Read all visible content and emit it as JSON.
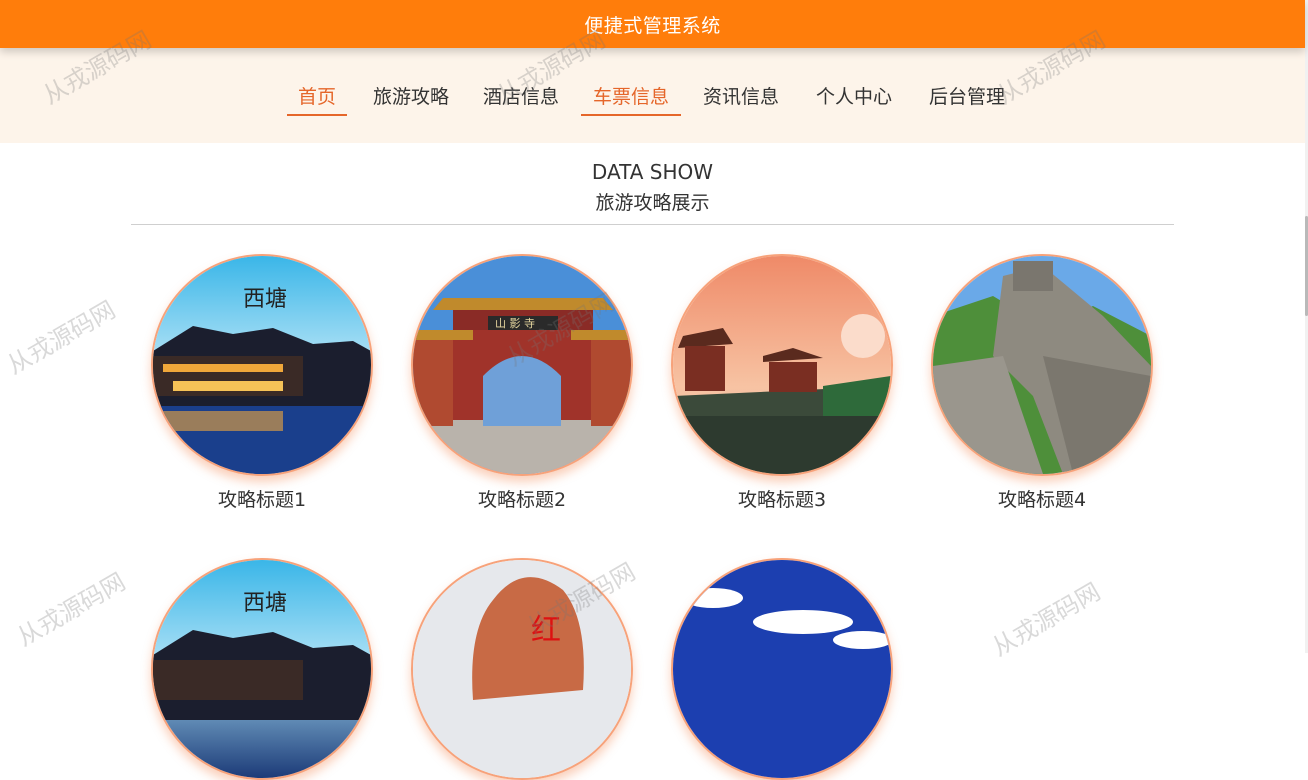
{
  "header": {
    "title": "便捷式管理系统"
  },
  "nav": {
    "items": [
      {
        "label": "首页",
        "active": true
      },
      {
        "label": "旅游攻略",
        "active": false
      },
      {
        "label": "酒店信息",
        "active": false
      },
      {
        "label": "车票信息",
        "active": true
      },
      {
        "label": "资讯信息",
        "active": false
      },
      {
        "label": "个人中心",
        "active": false
      },
      {
        "label": "后台管理",
        "active": false
      }
    ]
  },
  "section": {
    "title_en": "DATA SHOW",
    "title_cn": "旅游攻略展示"
  },
  "cards": [
    {
      "title": "攻略标题1",
      "image": "西塘 水乡夜景"
    },
    {
      "title": "攻略标题2",
      "image": "山影寺 牌楼"
    },
    {
      "title": "攻略标题3",
      "image": "古楼 夕阳"
    },
    {
      "title": "攻略标题4",
      "image": "长城"
    },
    {
      "title": "",
      "image": "西塘 水乡夜景"
    },
    {
      "title": "",
      "image": "红 字石碑"
    },
    {
      "title": "",
      "image": "蓝天白云"
    }
  ],
  "watermark": {
    "text": "从戎源码网"
  },
  "image_text": {
    "xitang": "西塘",
    "gate": "山 影 寺",
    "rock": "红"
  }
}
